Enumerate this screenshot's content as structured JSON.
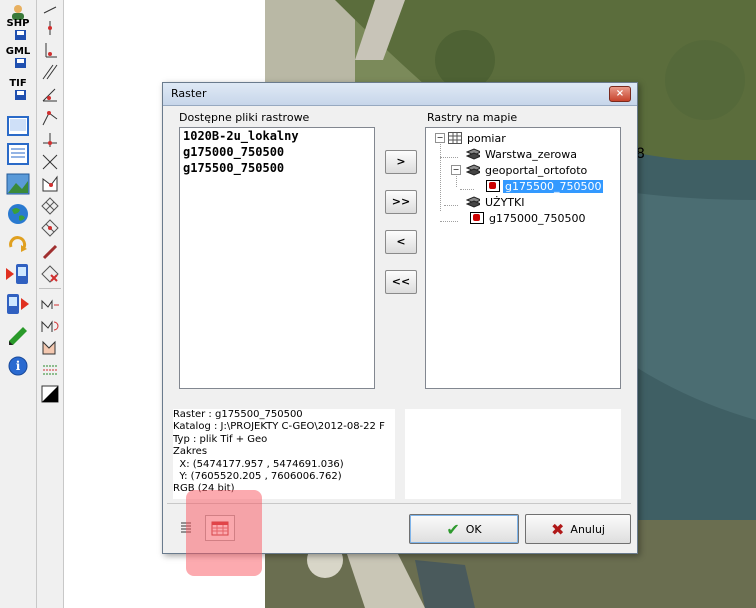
{
  "toolbar_primary": {
    "shp_label": "SHP",
    "gml_label": "GML",
    "tif_label": "TIF",
    "icons": [
      "user-icon",
      "save-shp-icon",
      "save-gml-icon",
      "save-tif-icon",
      "window-icon",
      "list-icon",
      "image-icon",
      "globe-icon",
      "refresh-icon",
      "import-device-icon",
      "export-device-icon",
      "edit-pencil-icon",
      "info-icon"
    ]
  },
  "toolbar_secondary": {
    "icons": [
      "point-icon",
      "perpendicular-icon",
      "parallel-icon",
      "angle-icon",
      "polyline-icon",
      "cross-icon",
      "cross2-icon",
      "area-icon",
      "grid-icon",
      "grid2-icon",
      "diagonal-icon",
      "erase-icon",
      "measure-icon",
      "rotate-icon",
      "area2-icon",
      "hatch-icon",
      "triangle-icon"
    ]
  },
  "map": {
    "visible_text": "8"
  },
  "dialog": {
    "title": "Raster",
    "close_label": "×",
    "available_label": "Dostępne pliki rastrowe",
    "available_files": [
      "1020B-2u_lokalny",
      "g175000_750500",
      "g175500_750500"
    ],
    "map_rasters_label": "Rastry na mapie",
    "move_buttons": {
      "add_one": ">",
      "add_all": ">>",
      "remove_one": "<",
      "remove_all": "<<"
    },
    "tree": {
      "root": "pomiar",
      "warstwa": "Warstwa_zerowa",
      "geoportal": "geoportal_ortofoto",
      "geoportal_child": "g175500_750500",
      "uzytki": "UŻYTKI",
      "raster_root": "g175000_750500"
    },
    "info": {
      "raster": "Raster   : g175500_750500",
      "katalog": "Katalog : J:\\PROJEKTY C-GEO\\2012-08-22 F",
      "typ": "Typ      : plik Tif + Geo",
      "zakres": "Zakres",
      "x": "  X: (5474177.957 , 5474691.036)",
      "y": "  Y: (7605520.205 , 7606006.762)",
      "rgb": "RGB (24 bit)"
    },
    "ok_label": "OK",
    "cancel_label": "Anuluj"
  },
  "colors": {
    "selection": "#3399ff",
    "highlight": "#fa555f",
    "ok_check": "#2e9a2e",
    "cancel_x": "#b01818"
  }
}
